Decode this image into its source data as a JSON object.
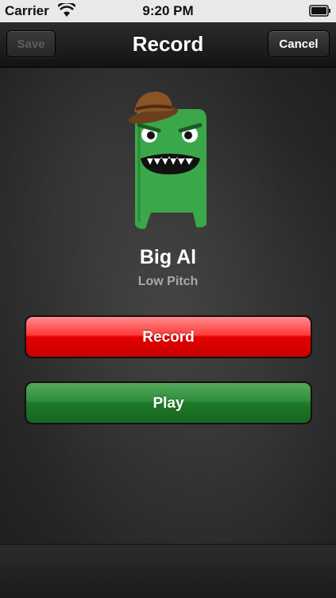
{
  "status_bar": {
    "carrier": "Carrier",
    "time": "9:20 PM"
  },
  "nav": {
    "title": "Record",
    "save_label": "Save",
    "cancel_label": "Cancel"
  },
  "character": {
    "name": "Big Al",
    "pitch": "Low Pitch",
    "icon": "green-monster-with-bowler-hat"
  },
  "buttons": {
    "record_label": "Record",
    "play_label": "Play"
  },
  "colors": {
    "record": "#e40000",
    "play": "#2f8e3a",
    "monster": "#3aa84a",
    "hat": "#7a4a22"
  }
}
